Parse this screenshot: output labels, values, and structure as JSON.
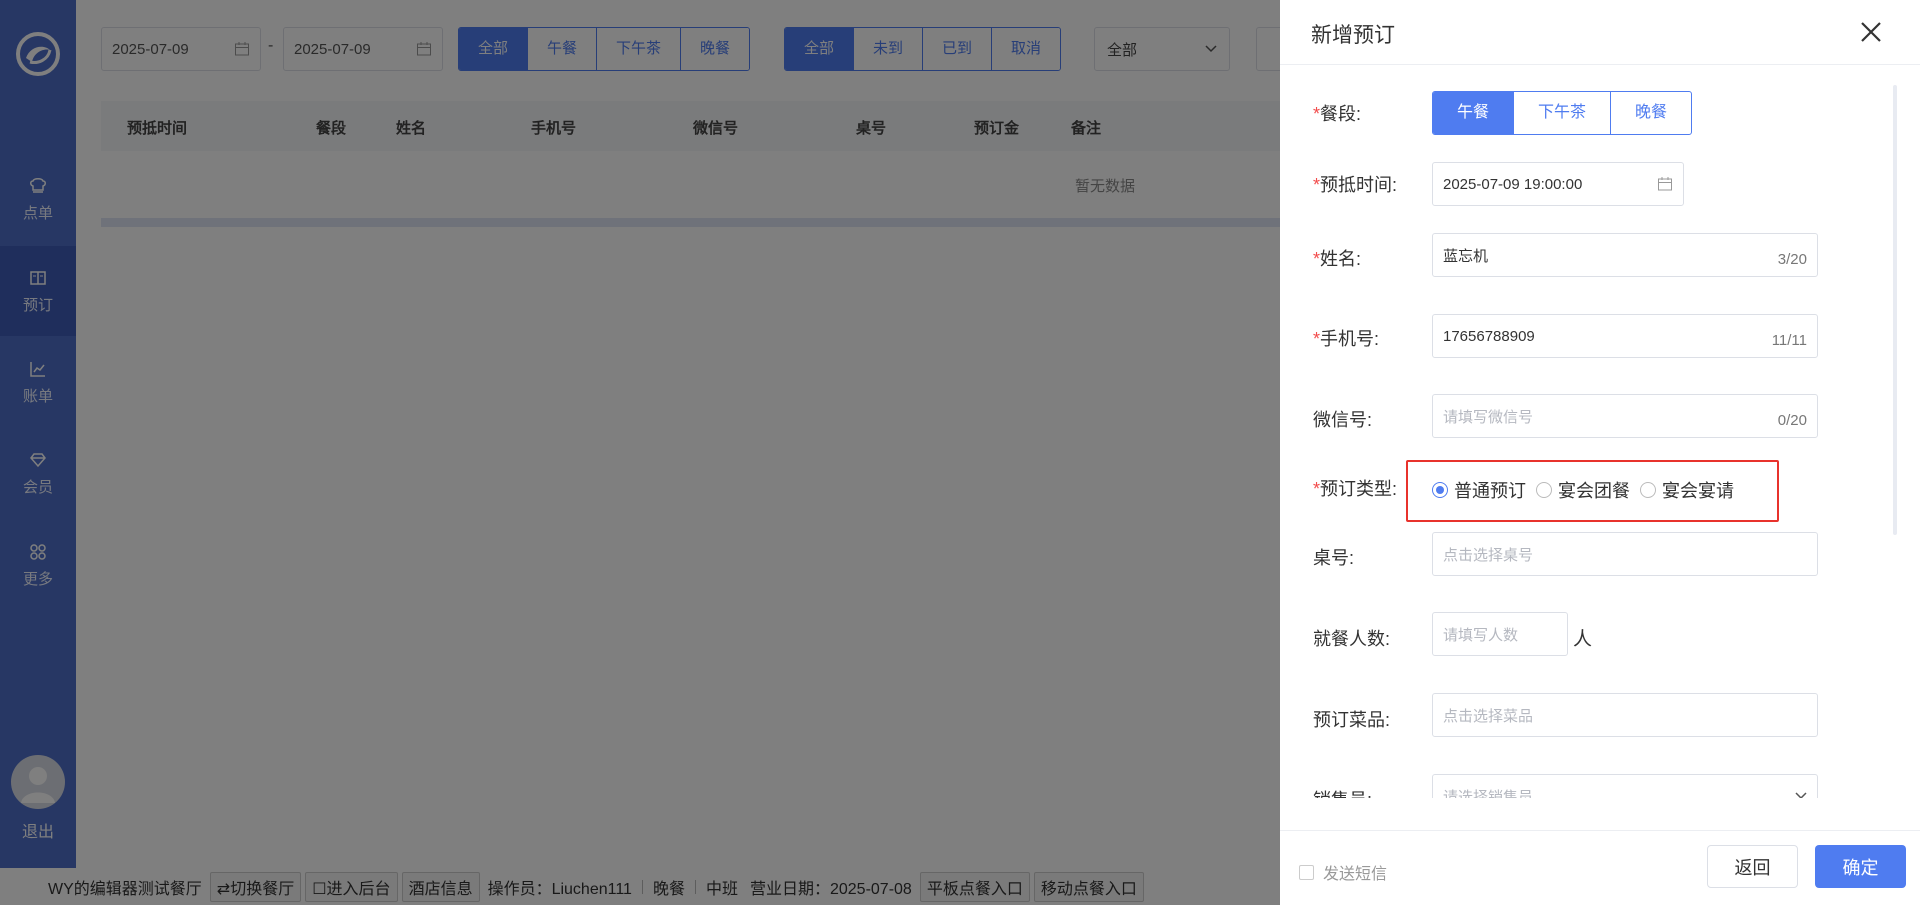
{
  "sidebar": {
    "items": [
      {
        "label": "点单",
        "icon": "chef-hat-icon"
      },
      {
        "label": "预订",
        "icon": "book-icon"
      },
      {
        "label": "账单",
        "icon": "chart-icon"
      },
      {
        "label": "会员",
        "icon": "diamond-icon"
      },
      {
        "label": "更多",
        "icon": "grid-icon"
      }
    ],
    "active_index": 1,
    "logout_label": "退出"
  },
  "filters": {
    "date_start": "2025-07-09",
    "date_separator": "-",
    "date_end": "2025-07-09",
    "meal_period": [
      "全部",
      "午餐",
      "下午茶",
      "晚餐"
    ],
    "status": [
      "全部",
      "未到",
      "已到",
      "取消"
    ],
    "type_select": "全部"
  },
  "table": {
    "columns": [
      "预抵时间",
      "餐段",
      "姓名",
      "手机号",
      "微信号",
      "桌号",
      "预订金",
      "备注"
    ],
    "empty_text": "暂无数据"
  },
  "statusbar": {
    "restaurant": "WY的编辑器测试餐厅",
    "switch_label": "⇄切换餐厅",
    "backend_label": "☐进入后台",
    "hotel_info": "酒店信息",
    "operator": "操作员：Liuchen111",
    "period": "晚餐",
    "shift": "中班",
    "business_date": "营业日期：2025-07-08",
    "tablet_entry": "平板点餐入口",
    "mobile_entry": "移动点餐入口"
  },
  "drawer": {
    "title": "新增预订",
    "meal_label": "餐段:",
    "meal_options": [
      "午餐",
      "下午茶",
      "晚餐"
    ],
    "meal_selected": "午餐",
    "time_label": "预抵时间:",
    "time_value": "2025-07-09 19:00:00",
    "name_label": "姓名:",
    "name_value": "蓝忘机",
    "name_count": "3/20",
    "phone_label": "手机号:",
    "phone_value": "17656788909",
    "phone_count": "11/11",
    "wechat_label": "微信号:",
    "wechat_placeholder": "请填写微信号",
    "wechat_count": "0/20",
    "type_label": "预订类型:",
    "type_options": [
      "普通预订",
      "宴会团餐",
      "宴会宴请"
    ],
    "type_selected": "普通预订",
    "table_label": "桌号:",
    "table_placeholder": "点击选择桌号",
    "people_label": "就餐人数:",
    "people_placeholder": "请填写人数",
    "people_unit": "人",
    "dishes_label": "预订菜品:",
    "dishes_placeholder": "点击选择菜品",
    "sales_label": "销售员:",
    "sales_placeholder": "请选择销售员",
    "sms_label": "发送短信",
    "back_label": "返回",
    "confirm_label": "确定"
  },
  "colors": {
    "primary": "#4f7cf0",
    "sidebar": "#4f6fc9",
    "required": "#f24b4b",
    "highlight": "#e8322c"
  }
}
